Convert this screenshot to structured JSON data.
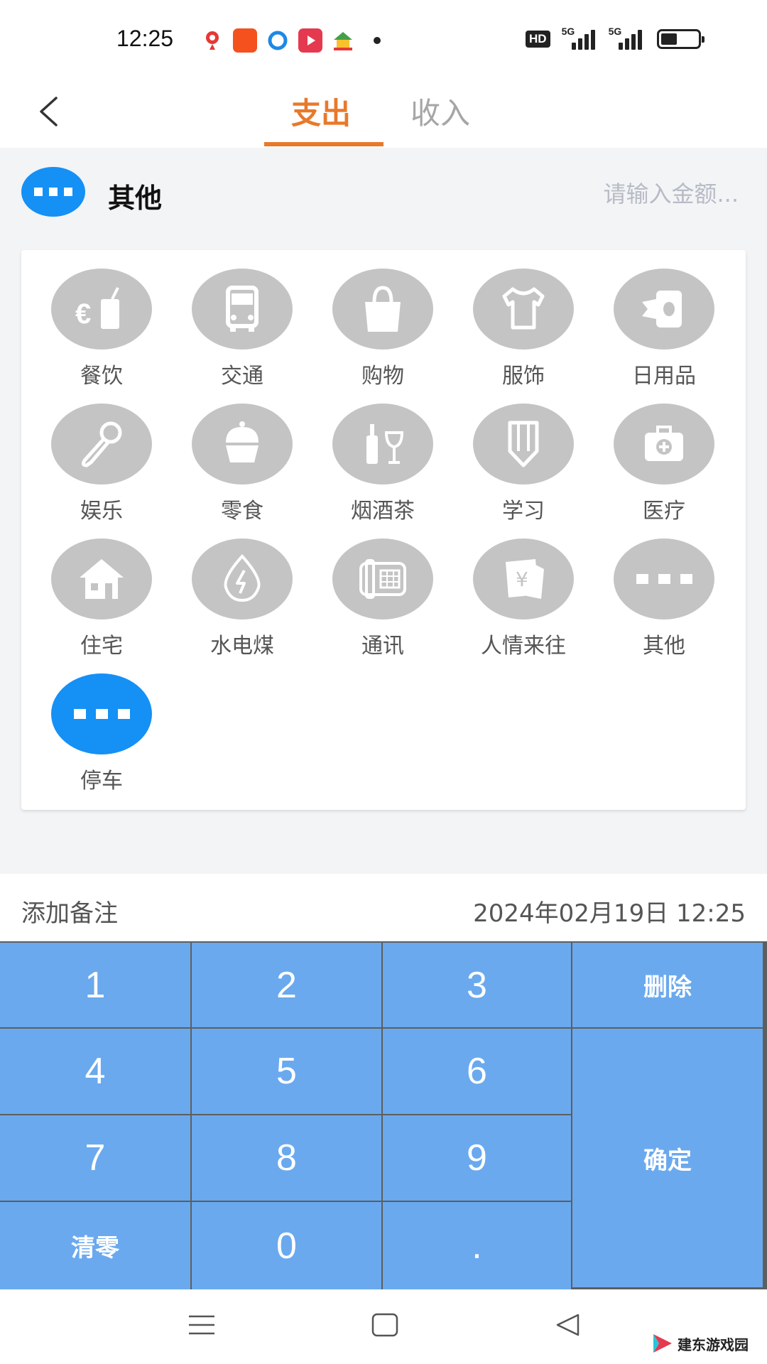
{
  "status_bar": {
    "time": "12:25",
    "hd": "HD",
    "network_1": "5G",
    "network_2": "5G"
  },
  "header": {
    "tabs": [
      {
        "label": "支出",
        "active": true
      },
      {
        "label": "收入",
        "active": false
      }
    ],
    "accent": "#e8792b"
  },
  "amount": {
    "category": "其他",
    "placeholder": "请输入金额..."
  },
  "categories": [
    {
      "label": "餐饮",
      "icon": "food-drink-icon"
    },
    {
      "label": "交通",
      "icon": "bus-icon"
    },
    {
      "label": "购物",
      "icon": "shopping-bag-icon"
    },
    {
      "label": "服饰",
      "icon": "tshirt-icon"
    },
    {
      "label": "日用品",
      "icon": "tissue-roll-icon"
    },
    {
      "label": "娱乐",
      "icon": "microphone-icon"
    },
    {
      "label": "零食",
      "icon": "cupcake-icon"
    },
    {
      "label": "烟酒茶",
      "icon": "wine-icon"
    },
    {
      "label": "学习",
      "icon": "pencil-icon"
    },
    {
      "label": "医疗",
      "icon": "medical-kit-icon"
    },
    {
      "label": "住宅",
      "icon": "house-icon"
    },
    {
      "label": "水电煤",
      "icon": "water-energy-icon"
    },
    {
      "label": "通讯",
      "icon": "phone-icon"
    },
    {
      "label": "人情来往",
      "icon": "red-envelope-icon"
    },
    {
      "label": "其他",
      "icon": "more-dots-icon"
    },
    {
      "label": "停车",
      "icon": "more-dots-icon",
      "selected": true
    }
  ],
  "note": {
    "label": "添加备注",
    "date": "2024年02月19日 12:25"
  },
  "keypad": {
    "k1": "1",
    "k2": "2",
    "k3": "3",
    "delete": "删除",
    "k4": "4",
    "k5": "5",
    "k6": "6",
    "k7": "7",
    "k8": "8",
    "k9": "9",
    "confirm": "确定",
    "clear": "清零",
    "k0": "0",
    "dot": "."
  },
  "watermark": {
    "text": "建东游戏园"
  },
  "colors": {
    "accent": "#e8792b",
    "selected_blue": "#1590f5",
    "key_blue": "#6aa9ee",
    "icon_gray": "#c4c4c4"
  }
}
